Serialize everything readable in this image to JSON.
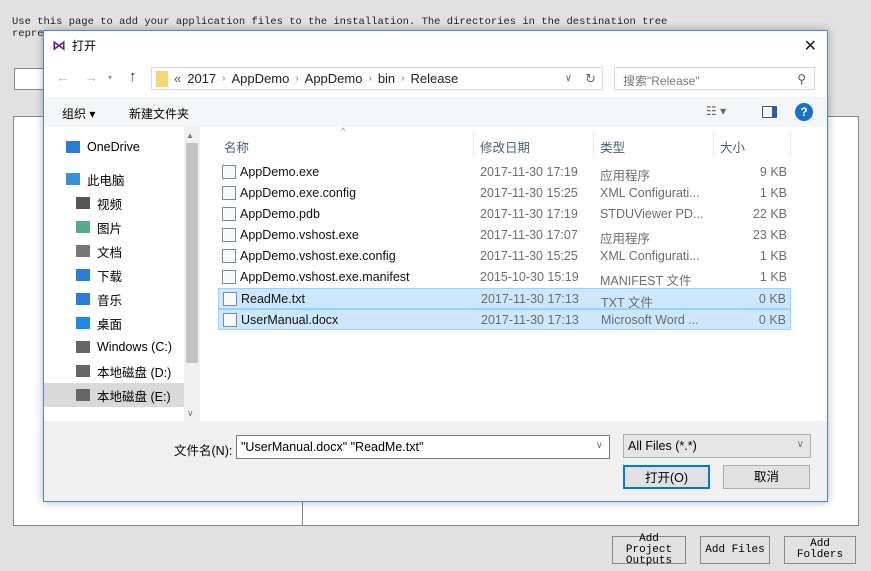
{
  "background": {
    "description_line1": "Use this page to add your application files to the installation. The directories in the destination tree",
    "description_line2": "repre",
    "buttons": {
      "add_project_outputs": "Add Project Outputs",
      "add_files": "Add Files",
      "add_folders": "Add Folders"
    }
  },
  "dialog": {
    "title": "打开",
    "breadcrumb": [
      "«",
      "2017",
      "AppDemo",
      "AppDemo",
      "bin",
      "Release"
    ],
    "search_placeholder": "搜索\"Release\"",
    "toolbar": {
      "organize": "组织 ▾",
      "new_folder": "新建文件夹"
    },
    "nav": [
      {
        "label": "OneDrive",
        "icon": "cloud-icon"
      },
      {
        "label": "此电脑",
        "icon": "computer-icon"
      },
      {
        "label": "视频",
        "icon": "video-icon"
      },
      {
        "label": "图片",
        "icon": "picture-icon"
      },
      {
        "label": "文档",
        "icon": "document-icon"
      },
      {
        "label": "下载",
        "icon": "download-icon"
      },
      {
        "label": "音乐",
        "icon": "music-icon"
      },
      {
        "label": "桌面",
        "icon": "desktop-icon"
      },
      {
        "label": "Windows (C:)",
        "icon": "drive-icon"
      },
      {
        "label": "本地磁盘 (D:)",
        "icon": "drive-icon"
      },
      {
        "label": "本地磁盘 (E:)",
        "icon": "drive-icon"
      }
    ],
    "columns": {
      "name": "名称",
      "date": "修改日期",
      "type": "类型",
      "size": "大小"
    },
    "files": [
      {
        "name": "AppDemo.exe",
        "date": "2017-11-30 17:19",
        "type": "应用程序",
        "size": "9 KB",
        "selected": false
      },
      {
        "name": "AppDemo.exe.config",
        "date": "2017-11-30 15:25",
        "type": "XML Configurati...",
        "size": "1 KB",
        "selected": false
      },
      {
        "name": "AppDemo.pdb",
        "date": "2017-11-30 17:19",
        "type": "STDUViewer PD...",
        "size": "22 KB",
        "selected": false
      },
      {
        "name": "AppDemo.vshost.exe",
        "date": "2017-11-30 17:07",
        "type": "应用程序",
        "size": "23 KB",
        "selected": false
      },
      {
        "name": "AppDemo.vshost.exe.config",
        "date": "2017-11-30 15:25",
        "type": "XML Configurati...",
        "size": "1 KB",
        "selected": false
      },
      {
        "name": "AppDemo.vshost.exe.manifest",
        "date": "2015-10-30 15:19",
        "type": "MANIFEST 文件",
        "size": "1 KB",
        "selected": false
      },
      {
        "name": "ReadMe.txt",
        "date": "2017-11-30 17:13",
        "type": "TXT 文件",
        "size": "0 KB",
        "selected": true
      },
      {
        "name": "UserManual.docx",
        "date": "2017-11-30 17:13",
        "type": "Microsoft Word ...",
        "size": "0 KB",
        "selected": true
      }
    ],
    "filename_label": "文件名(N):",
    "filename_value": "\"UserManual.docx\" \"ReadMe.txt\"",
    "filter": "All Files (*.*)",
    "open": "打开(O)",
    "cancel": "取消"
  }
}
